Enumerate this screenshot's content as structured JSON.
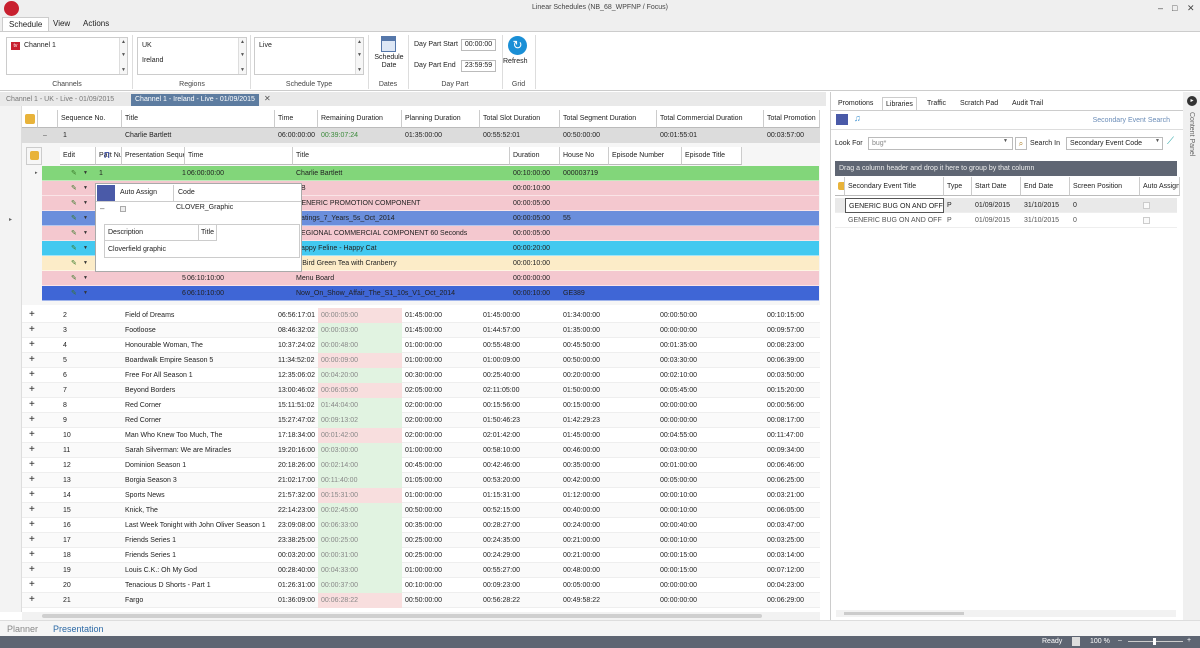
{
  "window": {
    "title": "Linear Schedules (NB_68_WPFNP / Focus)"
  },
  "menu": [
    {
      "label": "Schedule"
    },
    {
      "label": "View"
    },
    {
      "label": "Actions"
    }
  ],
  "ribbon": {
    "channels_group": "Channels",
    "regions_group": "Regions",
    "schedule_type_group": "Schedule Type",
    "dates_group": "Dates",
    "daypart_group": "Day Part",
    "grid_group": "Grid",
    "channels_items": [
      "Channel 1"
    ],
    "regions_items": [
      "UK",
      "Ireland"
    ],
    "schedule_type_items": [
      "Live"
    ],
    "schedule_date_label": "Schedule Date",
    "daypart_start_label": "Day Part Start",
    "daypart_start": "00:00:00",
    "daypart_end_label": "Day Part End",
    "daypart_end": "23:59:59",
    "refresh_label": "Refresh"
  },
  "doc_tabs": [
    {
      "label": "Channel 1 - UK - Live - 01/09/2015"
    },
    {
      "label": "Channel 1 - Ireland - Live - 01/09/2015"
    }
  ],
  "main_columns": [
    "Sequence No.",
    "Title",
    "Time",
    "Remaining Duration",
    "Planning Duration",
    "Total Slot Duration",
    "Total Segment Duration",
    "Total Commercial Duration",
    "Total Promotion"
  ],
  "main_expanded": {
    "seq": "1",
    "title": "Charlie Bartlett",
    "time": "06:00:00:00",
    "remaining": "00:39:07:24",
    "planning": "01:35:00:00",
    "slot": "00:55:52:01",
    "segment": "00:50:00:00",
    "commercial": "00:01:55:01",
    "promotion": "00:03:57:00"
  },
  "sub_columns": [
    "Edit",
    "Part Number",
    "Presentation Sequence No.",
    "Time",
    "Title",
    "Duration",
    "House No",
    "Episode Number",
    "Episode Title"
  ],
  "sub_rows": [
    {
      "part": "1",
      "pres": "1",
      "time": "06:00:00:00",
      "title": "Charlie Bartlett",
      "duration": "00:10:00:00",
      "house": "000003719"
    },
    {
      "part": "",
      "pres": "",
      "time": "06:10:00:00",
      "title": "CB",
      "duration": "00:00:10:00",
      "house": ""
    },
    {
      "part": "",
      "pres": "",
      "time": "06:10:00:00",
      "title": "GENERIC PROMOTION COMPONENT",
      "duration": "00:00:05:00",
      "house": ""
    },
    {
      "part": "",
      "pres": "",
      "time": "06:10:00:00",
      "title": "Ratings_7_Years_5s_Oct_2014",
      "duration": "00:00:05:00",
      "house": "55"
    },
    {
      "part": "",
      "pres": "",
      "time": "06:10:05:00",
      "title": "REGIONAL COMMERCIAL COMPONENT 60 Seconds",
      "duration": "00:00:05:00",
      "house": ""
    },
    {
      "part": "",
      "pres": "",
      "time": "06:10:05:00",
      "title": "Happy Feline - Happy Cat",
      "duration": "00:00:20:00",
      "house": ""
    },
    {
      "part": "",
      "pres": "",
      "time": "06:10:25:00",
      "title": "T-Bird Green Tea with Cranberry",
      "duration": "00:00:10:00",
      "house": ""
    },
    {
      "part": "",
      "pres": "5",
      "time": "06:10:10:00",
      "title": "Menu Board",
      "duration": "00:00:00:00",
      "house": ""
    },
    {
      "part": "",
      "pres": "6",
      "time": "06:10:10:00",
      "title": "Now_On_Show_Affair_The_S1_10s_V1_Oct_2014",
      "duration": "00:00:10:00",
      "house": "GE389"
    }
  ],
  "popup": {
    "col_auto": "Auto Assign",
    "col_code": "Code",
    "code_value": "CLOVER_Graphic",
    "col_description": "Description",
    "col_title": "Title",
    "description_value": "Cloverfield graphic"
  },
  "main_rows": [
    {
      "seq": "2",
      "title": "Field of Dreams",
      "time": "06:56:17:01",
      "remaining": "00:00:05:00",
      "planning": "01:45:00:00",
      "slot": "01:45:00:00",
      "segment": "01:34:00:00",
      "commercial": "00:00:50:00",
      "promotion": "00:10:15:00"
    },
    {
      "seq": "3",
      "title": "Footloose",
      "time": "08:46:32:02",
      "remaining": "00:00:03:00",
      "planning": "01:45:00:00",
      "slot": "01:44:57:00",
      "segment": "01:35:00:00",
      "commercial": "00:00:00:00",
      "promotion": "00:09:57:00"
    },
    {
      "seq": "4",
      "title": "Honourable Woman, The",
      "time": "10:37:24:02",
      "remaining": "00:00:48:00",
      "planning": "01:00:00:00",
      "slot": "00:55:48:00",
      "segment": "00:45:50:00",
      "commercial": "00:01:35:00",
      "promotion": "00:08:23:00"
    },
    {
      "seq": "5",
      "title": "Boardwalk Empire Season 5",
      "time": "11:34:52:02",
      "remaining": "00:00:09:00",
      "planning": "01:00:00:00",
      "slot": "01:00:09:00",
      "segment": "00:50:00:00",
      "commercial": "00:03:30:00",
      "promotion": "00:06:39:00"
    },
    {
      "seq": "6",
      "title": "Free For All Season 1",
      "time": "12:35:06:02",
      "remaining": "00:04:20:00",
      "planning": "00:30:00:00",
      "slot": "00:25:40:00",
      "segment": "00:20:00:00",
      "commercial": "00:02:10:00",
      "promotion": "00:03:50:00"
    },
    {
      "seq": "7",
      "title": "Beyond Borders",
      "time": "13:00:46:02",
      "remaining": "00:06:05:00",
      "planning": "02:05:00:00",
      "slot": "02:11:05:00",
      "segment": "01:50:00:00",
      "commercial": "00:05:45:00",
      "promotion": "00:15:20:00"
    },
    {
      "seq": "8",
      "title": "Red Corner",
      "time": "15:11:51:02",
      "remaining": "01:44:04:00",
      "planning": "02:00:00:00",
      "slot": "00:15:56:00",
      "segment": "00:15:00:00",
      "commercial": "00:00:00:00",
      "promotion": "00:00:56:00"
    },
    {
      "seq": "9",
      "title": "Red Corner",
      "time": "15:27:47:02",
      "remaining": "00:09:13:02",
      "planning": "02:00:00:00",
      "slot": "01:50:46:23",
      "segment": "01:42:29:23",
      "commercial": "00:00:00:00",
      "promotion": "00:08:17:00"
    },
    {
      "seq": "10",
      "title": "Man Who Knew Too Much, The",
      "time": "17:18:34:00",
      "remaining": "00:01:42:00",
      "planning": "02:00:00:00",
      "slot": "02:01:42:00",
      "segment": "01:45:00:00",
      "commercial": "00:04:55:00",
      "promotion": "00:11:47:00"
    },
    {
      "seq": "11",
      "title": "Sarah Silverman: We are Miracles",
      "time": "19:20:16:00",
      "remaining": "00:03:00:00",
      "planning": "01:00:00:00",
      "slot": "00:58:10:00",
      "segment": "00:46:00:00",
      "commercial": "00:03:00:00",
      "promotion": "00:09:34:00"
    },
    {
      "seq": "12",
      "title": "Dominion Season 1",
      "time": "20:18:26:00",
      "remaining": "00:02:14:00",
      "planning": "00:45:00:00",
      "slot": "00:42:46:00",
      "segment": "00:35:00:00",
      "commercial": "00:01:00:00",
      "promotion": "00:06:46:00"
    },
    {
      "seq": "13",
      "title": "Borgia Season 3",
      "time": "21:02:17:00",
      "remaining": "00:11:40:00",
      "planning": "01:05:00:00",
      "slot": "00:53:20:00",
      "segment": "00:42:00:00",
      "commercial": "00:05:00:00",
      "promotion": "00:06:25:00"
    },
    {
      "seq": "14",
      "title": "Sports News",
      "time": "21:57:32:00",
      "remaining": "00:15:31:00",
      "planning": "01:00:00:00",
      "slot": "01:15:31:00",
      "segment": "01:12:00:00",
      "commercial": "00:00:10:00",
      "promotion": "00:03:21:00"
    },
    {
      "seq": "15",
      "title": "Knick, The",
      "time": "22:14:23:00",
      "remaining": "00:02:45:00",
      "planning": "00:50:00:00",
      "slot": "00:52:15:00",
      "segment": "00:40:00:00",
      "commercial": "00:00:10:00",
      "promotion": "00:06:05:00"
    },
    {
      "seq": "16",
      "title": "Last Week Tonight with John Oliver Season 1",
      "time": "23:09:08:00",
      "remaining": "00:06:33:00",
      "planning": "00:35:00:00",
      "slot": "00:28:27:00",
      "segment": "00:24:00:00",
      "commercial": "00:00:40:00",
      "promotion": "00:03:47:00"
    },
    {
      "seq": "17",
      "title": "Friends Series 1",
      "time": "23:38:25:00",
      "remaining": "00:00:25:00",
      "planning": "00:25:00:00",
      "slot": "00:24:35:00",
      "segment": "00:21:00:00",
      "commercial": "00:00:10:00",
      "promotion": "00:03:25:00"
    },
    {
      "seq": "18",
      "title": "Friends Series 1",
      "time": "00:03:20:00",
      "remaining": "00:00:31:00",
      "planning": "00:25:00:00",
      "slot": "00:24:29:00",
      "segment": "00:21:00:00",
      "commercial": "00:00:15:00",
      "promotion": "00:03:14:00"
    },
    {
      "seq": "19",
      "title": "Louis C.K.: Oh My God",
      "time": "00:28:40:00",
      "remaining": "00:04:33:00",
      "planning": "01:00:00:00",
      "slot": "00:55:27:00",
      "segment": "00:48:00:00",
      "commercial": "00:00:15:00",
      "promotion": "00:07:12:00"
    },
    {
      "seq": "20",
      "title": "Tenacious D Shorts - Part 1",
      "time": "01:26:31:00",
      "remaining": "00:00:37:00",
      "planning": "00:10:00:00",
      "slot": "00:09:23:00",
      "segment": "00:05:00:00",
      "commercial": "00:00:00:00",
      "promotion": "00:04:23:00"
    },
    {
      "seq": "21",
      "title": "Fargo",
      "time": "01:36:09:00",
      "remaining": "00:06:28:22",
      "planning": "00:50:00:00",
      "slot": "00:56:28:22",
      "segment": "00:49:58:22",
      "commercial": "00:00:00:00",
      "promotion": "00:06:29:00"
    }
  ],
  "right": {
    "tabs": [
      {
        "label": "Promotions"
      },
      {
        "label": "Libraries"
      },
      {
        "label": "Traffic"
      },
      {
        "label": "Scratch Pad"
      },
      {
        "label": "Audit Trail"
      }
    ],
    "search_header": "Secondary Event Search",
    "look_for_label": "Look For",
    "look_for_value": "bug*",
    "search_in_label": "Search In",
    "search_in_value": "Secondary Event Code",
    "group_hint": "Drag a column header and drop it here to group by that column",
    "columns": [
      "Secondary Event Title",
      "Type",
      "Start Date",
      "End Date",
      "Screen Position",
      "Auto Assign"
    ],
    "rows": [
      {
        "title": "GENERIC BUG ON AND OFF",
        "type": "P",
        "start": "01/09/2015",
        "end": "31/10/2015",
        "screen": "0"
      },
      {
        "title": "GENERIC BUG ON AND OFF",
        "type": "P",
        "start": "01/09/2015",
        "end": "31/10/2015",
        "screen": "0"
      }
    ],
    "side_label": "Content Panel"
  },
  "bottom_tabs": [
    {
      "label": "Planner"
    },
    {
      "label": "Presentation"
    }
  ],
  "status": {
    "ready": "Ready",
    "zoom": "100 %"
  },
  "colors": {
    "pink": "#f4c8cf",
    "blue": "#6a8edc",
    "green": "#82d67a",
    "cyan": "#43c9f0",
    "cream": "#fcecc8",
    "dark_blue": "#3f66d6",
    "remaining_green": "#e1f3e1",
    "remaining_pink": "#f8dede"
  }
}
